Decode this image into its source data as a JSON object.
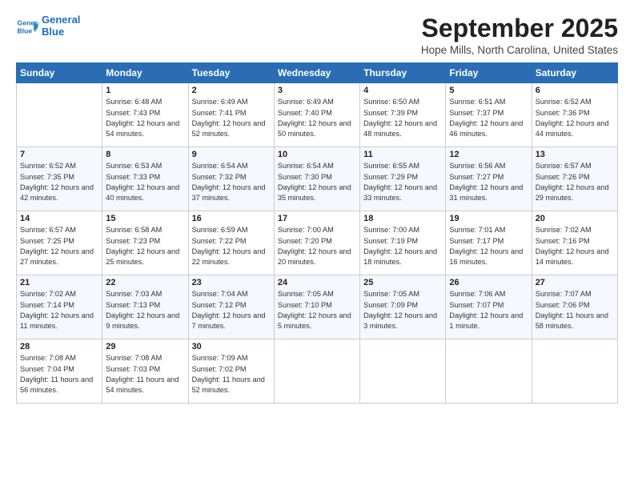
{
  "logo": {
    "line1": "General",
    "line2": "Blue"
  },
  "title": "September 2025",
  "location": "Hope Mills, North Carolina, United States",
  "days_header": [
    "Sunday",
    "Monday",
    "Tuesday",
    "Wednesday",
    "Thursday",
    "Friday",
    "Saturday"
  ],
  "weeks": [
    [
      {
        "num": "",
        "sunrise": "",
        "sunset": "",
        "daylight": ""
      },
      {
        "num": "1",
        "sunrise": "Sunrise: 6:48 AM",
        "sunset": "Sunset: 7:43 PM",
        "daylight": "Daylight: 12 hours and 54 minutes."
      },
      {
        "num": "2",
        "sunrise": "Sunrise: 6:49 AM",
        "sunset": "Sunset: 7:41 PM",
        "daylight": "Daylight: 12 hours and 52 minutes."
      },
      {
        "num": "3",
        "sunrise": "Sunrise: 6:49 AM",
        "sunset": "Sunset: 7:40 PM",
        "daylight": "Daylight: 12 hours and 50 minutes."
      },
      {
        "num": "4",
        "sunrise": "Sunrise: 6:50 AM",
        "sunset": "Sunset: 7:39 PM",
        "daylight": "Daylight: 12 hours and 48 minutes."
      },
      {
        "num": "5",
        "sunrise": "Sunrise: 6:51 AM",
        "sunset": "Sunset: 7:37 PM",
        "daylight": "Daylight: 12 hours and 46 minutes."
      },
      {
        "num": "6",
        "sunrise": "Sunrise: 6:52 AM",
        "sunset": "Sunset: 7:36 PM",
        "daylight": "Daylight: 12 hours and 44 minutes."
      }
    ],
    [
      {
        "num": "7",
        "sunrise": "Sunrise: 6:52 AM",
        "sunset": "Sunset: 7:35 PM",
        "daylight": "Daylight: 12 hours and 42 minutes."
      },
      {
        "num": "8",
        "sunrise": "Sunrise: 6:53 AM",
        "sunset": "Sunset: 7:33 PM",
        "daylight": "Daylight: 12 hours and 40 minutes."
      },
      {
        "num": "9",
        "sunrise": "Sunrise: 6:54 AM",
        "sunset": "Sunset: 7:32 PM",
        "daylight": "Daylight: 12 hours and 37 minutes."
      },
      {
        "num": "10",
        "sunrise": "Sunrise: 6:54 AM",
        "sunset": "Sunset: 7:30 PM",
        "daylight": "Daylight: 12 hours and 35 minutes."
      },
      {
        "num": "11",
        "sunrise": "Sunrise: 6:55 AM",
        "sunset": "Sunset: 7:29 PM",
        "daylight": "Daylight: 12 hours and 33 minutes."
      },
      {
        "num": "12",
        "sunrise": "Sunrise: 6:56 AM",
        "sunset": "Sunset: 7:27 PM",
        "daylight": "Daylight: 12 hours and 31 minutes."
      },
      {
        "num": "13",
        "sunrise": "Sunrise: 6:57 AM",
        "sunset": "Sunset: 7:26 PM",
        "daylight": "Daylight: 12 hours and 29 minutes."
      }
    ],
    [
      {
        "num": "14",
        "sunrise": "Sunrise: 6:57 AM",
        "sunset": "Sunset: 7:25 PM",
        "daylight": "Daylight: 12 hours and 27 minutes."
      },
      {
        "num": "15",
        "sunrise": "Sunrise: 6:58 AM",
        "sunset": "Sunset: 7:23 PM",
        "daylight": "Daylight: 12 hours and 25 minutes."
      },
      {
        "num": "16",
        "sunrise": "Sunrise: 6:59 AM",
        "sunset": "Sunset: 7:22 PM",
        "daylight": "Daylight: 12 hours and 22 minutes."
      },
      {
        "num": "17",
        "sunrise": "Sunrise: 7:00 AM",
        "sunset": "Sunset: 7:20 PM",
        "daylight": "Daylight: 12 hours and 20 minutes."
      },
      {
        "num": "18",
        "sunrise": "Sunrise: 7:00 AM",
        "sunset": "Sunset: 7:19 PM",
        "daylight": "Daylight: 12 hours and 18 minutes."
      },
      {
        "num": "19",
        "sunrise": "Sunrise: 7:01 AM",
        "sunset": "Sunset: 7:17 PM",
        "daylight": "Daylight: 12 hours and 16 minutes."
      },
      {
        "num": "20",
        "sunrise": "Sunrise: 7:02 AM",
        "sunset": "Sunset: 7:16 PM",
        "daylight": "Daylight: 12 hours and 14 minutes."
      }
    ],
    [
      {
        "num": "21",
        "sunrise": "Sunrise: 7:02 AM",
        "sunset": "Sunset: 7:14 PM",
        "daylight": "Daylight: 12 hours and 11 minutes."
      },
      {
        "num": "22",
        "sunrise": "Sunrise: 7:03 AM",
        "sunset": "Sunset: 7:13 PM",
        "daylight": "Daylight: 12 hours and 9 minutes."
      },
      {
        "num": "23",
        "sunrise": "Sunrise: 7:04 AM",
        "sunset": "Sunset: 7:12 PM",
        "daylight": "Daylight: 12 hours and 7 minutes."
      },
      {
        "num": "24",
        "sunrise": "Sunrise: 7:05 AM",
        "sunset": "Sunset: 7:10 PM",
        "daylight": "Daylight: 12 hours and 5 minutes."
      },
      {
        "num": "25",
        "sunrise": "Sunrise: 7:05 AM",
        "sunset": "Sunset: 7:09 PM",
        "daylight": "Daylight: 12 hours and 3 minutes."
      },
      {
        "num": "26",
        "sunrise": "Sunrise: 7:06 AM",
        "sunset": "Sunset: 7:07 PM",
        "daylight": "Daylight: 12 hours and 1 minute."
      },
      {
        "num": "27",
        "sunrise": "Sunrise: 7:07 AM",
        "sunset": "Sunset: 7:06 PM",
        "daylight": "Daylight: 11 hours and 58 minutes."
      }
    ],
    [
      {
        "num": "28",
        "sunrise": "Sunrise: 7:08 AM",
        "sunset": "Sunset: 7:04 PM",
        "daylight": "Daylight: 11 hours and 56 minutes."
      },
      {
        "num": "29",
        "sunrise": "Sunrise: 7:08 AM",
        "sunset": "Sunset: 7:03 PM",
        "daylight": "Daylight: 11 hours and 54 minutes."
      },
      {
        "num": "30",
        "sunrise": "Sunrise: 7:09 AM",
        "sunset": "Sunset: 7:02 PM",
        "daylight": "Daylight: 11 hours and 52 minutes."
      },
      {
        "num": "",
        "sunrise": "",
        "sunset": "",
        "daylight": ""
      },
      {
        "num": "",
        "sunrise": "",
        "sunset": "",
        "daylight": ""
      },
      {
        "num": "",
        "sunrise": "",
        "sunset": "",
        "daylight": ""
      },
      {
        "num": "",
        "sunrise": "",
        "sunset": "",
        "daylight": ""
      }
    ]
  ]
}
